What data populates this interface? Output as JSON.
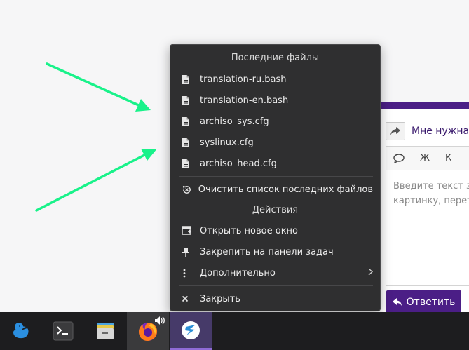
{
  "background_window": {
    "topic_title": "Мне нужна п",
    "editor_toolbar": {
      "bold": "Ж",
      "italic": "К"
    },
    "editor_placeholder": "Введите текст з\nкартинку, перет",
    "reply_button_label": "Ответить"
  },
  "menu": {
    "recent_header": "Последние файлы",
    "recent_files": [
      {
        "label": "translation-ru.bash",
        "icon": "file-icon"
      },
      {
        "label": "translation-en.bash",
        "icon": "file-icon"
      },
      {
        "label": "archiso_sys.cfg",
        "icon": "file-icon"
      },
      {
        "label": "syslinux.cfg",
        "icon": "file-icon"
      },
      {
        "label": "archiso_head.cfg",
        "icon": "file-icon"
      }
    ],
    "clear_recent": "Очистить список последних файлов",
    "actions_header": "Действия",
    "actions": {
      "new_window": "Открыть новое окно",
      "pin": "Закрепить на панели задач",
      "more": "Дополнительно",
      "close": "Закрыть"
    }
  },
  "taskbar": {
    "items": [
      {
        "name": "duck-app",
        "icon": "duck-icon"
      },
      {
        "name": "terminal",
        "icon": "terminal-icon"
      },
      {
        "name": "file-manager",
        "icon": "file-cabinet-icon"
      },
      {
        "name": "firefox",
        "icon": "firefox-icon",
        "audio": "speaker-icon"
      },
      {
        "name": "kate-editor",
        "icon": "kate-icon",
        "active": true
      }
    ]
  },
  "colors": {
    "menu_bg": "#2f2f30",
    "accent_purple": "#4b1e86",
    "arrow_green": "#19f28a",
    "taskbar_bg": "#1d1d1f"
  }
}
